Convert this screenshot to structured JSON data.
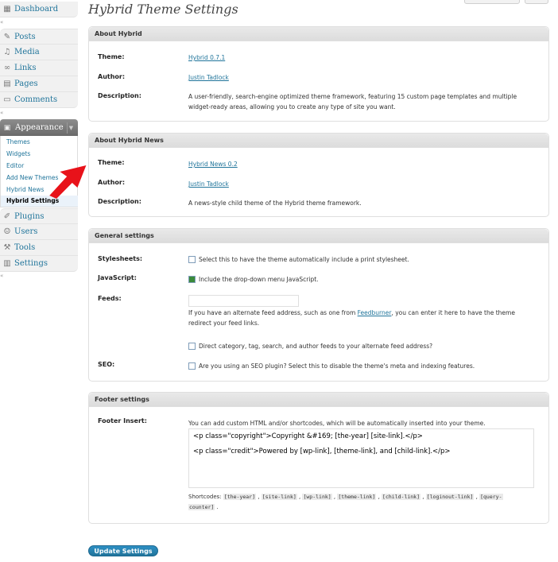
{
  "sidebar": {
    "dashboard": "Dashboard",
    "items": [
      {
        "label": "Posts",
        "icon": "pin-icon"
      },
      {
        "label": "Media",
        "icon": "media-icon"
      },
      {
        "label": "Links",
        "icon": "links-icon"
      },
      {
        "label": "Pages",
        "icon": "pages-icon"
      },
      {
        "label": "Comments",
        "icon": "comments-icon"
      }
    ],
    "appearance": "Appearance",
    "appearance_sub": [
      "Themes",
      "Widgets",
      "Editor",
      "Add New Themes",
      "Hybrid News",
      "Hybrid Settings"
    ],
    "bottom_items": [
      {
        "label": "Plugins",
        "icon": "plugins-icon"
      },
      {
        "label": "Users",
        "icon": "users-icon"
      },
      {
        "label": "Tools",
        "icon": "tools-icon"
      },
      {
        "label": "Settings",
        "icon": "settings-icon"
      }
    ]
  },
  "page": {
    "title": "Hybrid Theme Settings"
  },
  "about_hybrid": {
    "heading": "About Hybrid",
    "theme_label": "Theme:",
    "theme_value": "Hybrid 0.7.1",
    "author_label": "Author:",
    "author_value": "Justin Tadlock",
    "description_label": "Description:",
    "description_line1": "A user-friendly, search-engine optimized theme framework, featuring 15 custom page templates and multiple",
    "description_line2": "widget-ready areas, allowing you to create any type of site you want."
  },
  "about_news": {
    "heading": "About Hybrid News",
    "theme_label": "Theme:",
    "theme_value": "Hybrid News 0.2",
    "author_label": "Author:",
    "author_value": "Justin Tadlock",
    "description_label": "Description:",
    "description_value": "A news-style child theme of the Hybrid theme framework."
  },
  "general": {
    "heading": "General settings",
    "stylesheets_label": "Stylesheets:",
    "stylesheets_text": "Select this to have the theme automatically include a print stylesheet.",
    "stylesheets_checked": false,
    "javascript_label": "JavaScript:",
    "javascript_text": "Include the drop-down menu JavaScript.",
    "javascript_checked": true,
    "feeds_label": "Feeds:",
    "feeds_value": "",
    "feeds_help_pre": "If you have an alternate feed address, such as one from ",
    "feeds_help_link": "Feedburner",
    "feeds_help_post": ", you can enter it here to have the theme",
    "feeds_help_line2": "redirect your feed links.",
    "direct_text": "Direct category, tag, search, and author feeds to your alternate feed address?",
    "direct_checked": false,
    "seo_label": "SEO:",
    "seo_text": "Are you using an SEO plugin? Select this to disable the theme's meta and indexing features.",
    "seo_checked": false
  },
  "footer": {
    "heading": "Footer settings",
    "insert_label": "Footer Insert:",
    "help_text": "You can add custom HTML and/or shortcodes, which will be automatically inserted into your theme.",
    "textarea_line1": "<p class=\"copyright\">Copyright &#169; [the-year] [site-link].</p>",
    "textarea_line2": "<p class=\"credit\">Powered by [wp-link], [theme-link], and [child-link].</p>",
    "shortcodes_label": "Shortcodes:",
    "shortcodes": [
      "[the-year]",
      "[site-link]",
      "[wp-link]",
      "[theme-link]",
      "[child-link]",
      "[loginout-link]",
      "[query-",
      "counter]"
    ]
  },
  "update_button": "Update Settings",
  "colors": {
    "link": "#21759b",
    "arrow": "#e8121a",
    "check": "#3a8a3a"
  }
}
